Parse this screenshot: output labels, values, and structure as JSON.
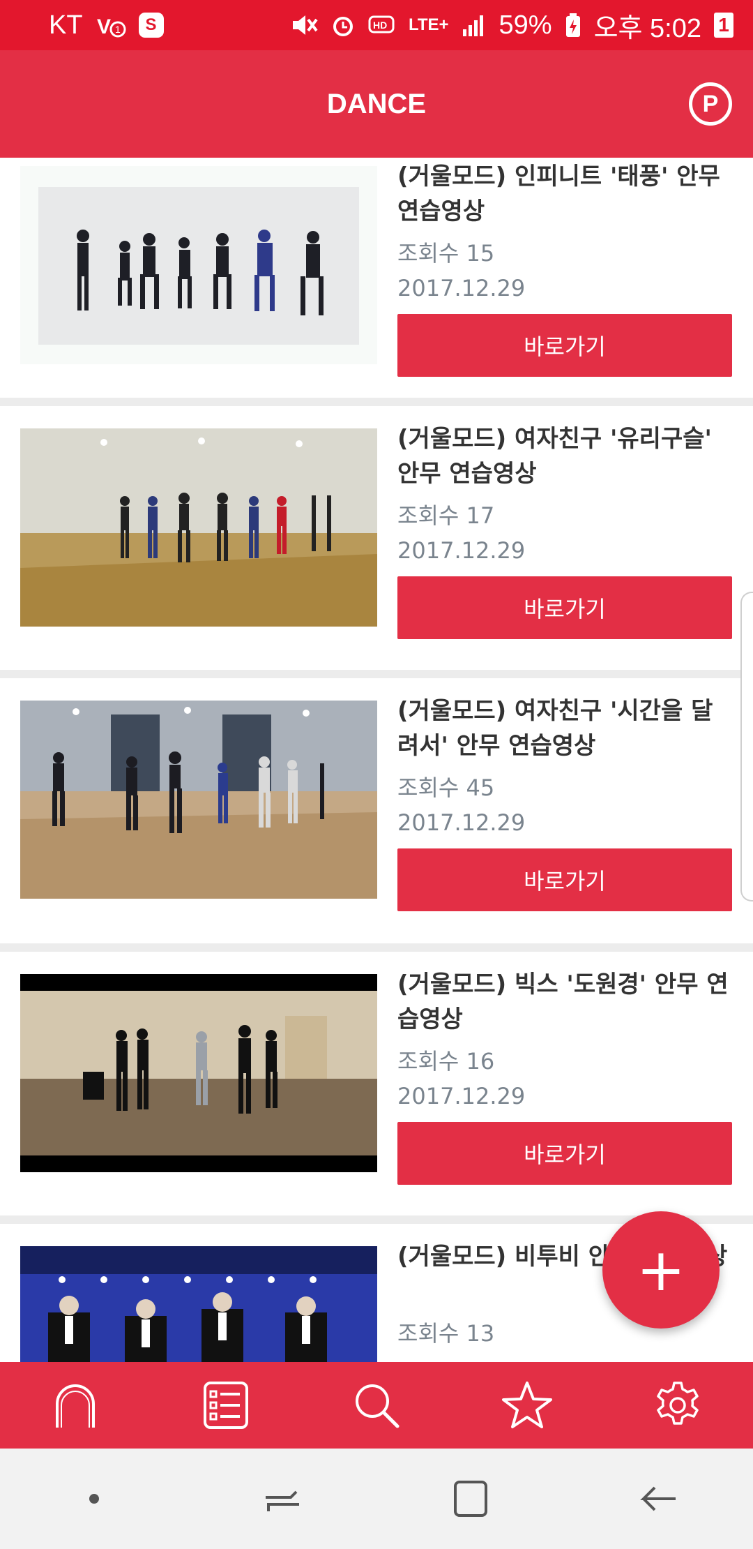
{
  "status_bar": {
    "carrier": "KT",
    "battery": "59%",
    "time": "오후 5:02",
    "network": "LTE+",
    "notification_count": "1"
  },
  "app_bar": {
    "title": "DANCE",
    "premium_label": "P"
  },
  "videos": [
    {
      "title": "(거울모드)  인피니트 '태풍' 안무 연습영상",
      "views": "조회수 15",
      "date": "2017.12.29",
      "button": "바로가기"
    },
    {
      "title": "(거울모드)  여자친구 '유리구슬' 안무 연습영상",
      "views": "조회수 17",
      "date": "2017.12.29",
      "button": "바로가기"
    },
    {
      "title": "(거울모드)  여자친구 '시간을 달려서' 안무 연습영상",
      "views": "조회수 45",
      "date": "2017.12.29",
      "button": "바로가기"
    },
    {
      "title": "(거울모드)  빅스 '도원경' 안무 연습영상",
      "views": "조회수 16",
      "date": "2017.12.29",
      "button": "바로가기"
    },
    {
      "title": "(거울모드)  비투비 안무 연습영상",
      "views": "조회수 13",
      "date": "",
      "button": ""
    }
  ],
  "fab": {
    "label": "+"
  },
  "bottom_nav": [
    {
      "name": "home",
      "icon": "home-icon"
    },
    {
      "name": "list",
      "icon": "list-icon"
    },
    {
      "name": "search",
      "icon": "search-icon"
    },
    {
      "name": "favorites",
      "icon": "star-icon"
    },
    {
      "name": "settings",
      "icon": "gear-icon"
    }
  ],
  "colors": {
    "accent": "#e32f45",
    "status": "#e3172d",
    "meta_text": "#7a848e"
  }
}
